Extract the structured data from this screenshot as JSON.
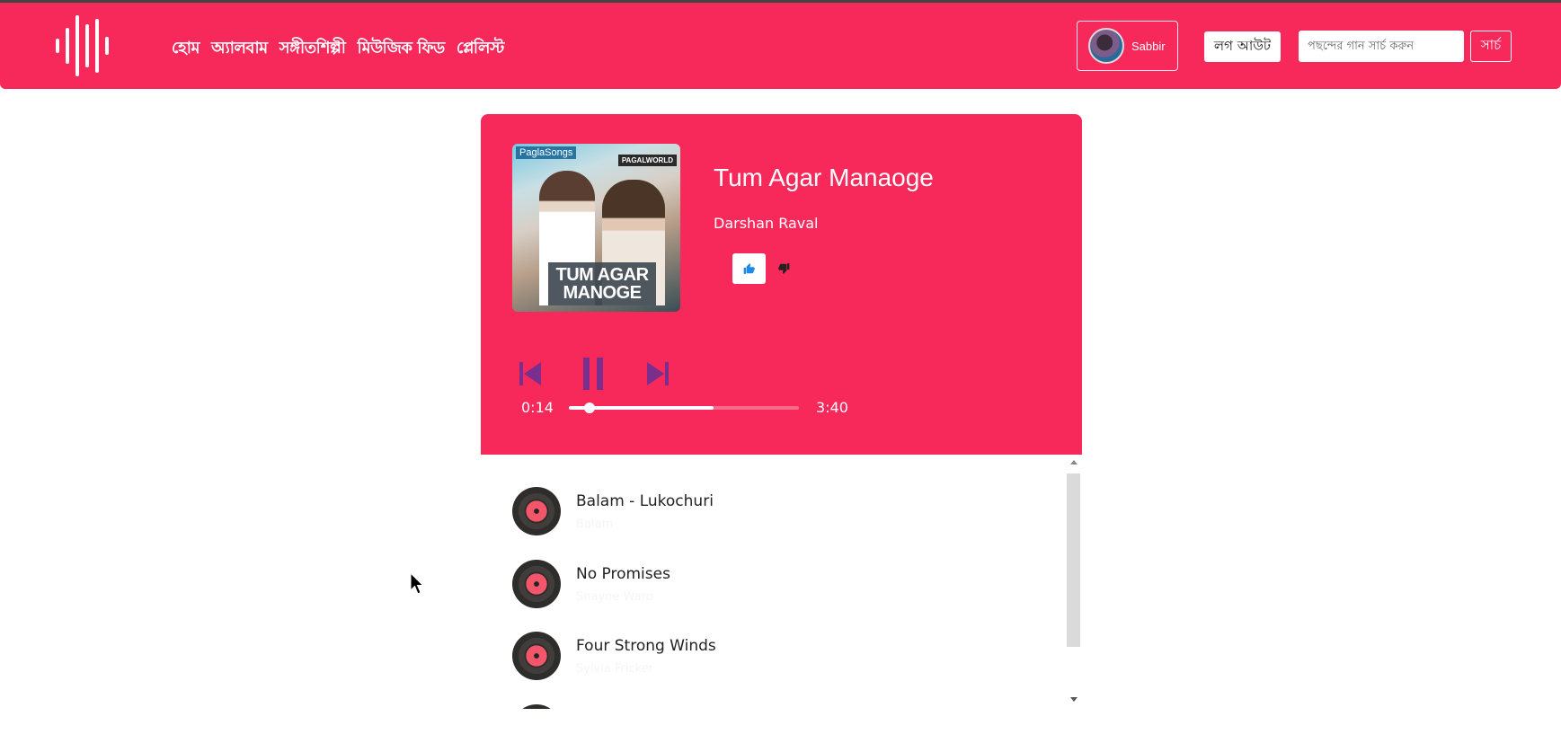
{
  "navbar": {
    "logo_icon": "sound-wave-icon",
    "links": [
      {
        "label": "হোম"
      },
      {
        "label": "অ্যালবাম"
      },
      {
        "label": "সঙ্গীতশিল্পী"
      },
      {
        "label": "মিউজিক ফিড"
      },
      {
        "label": "প্লেলিস্ট"
      }
    ],
    "user": {
      "name": "Sabbir"
    },
    "logout_label": "লগ আউট",
    "search": {
      "placeholder": "পছন্দের গান সার্চ করুন",
      "value": "",
      "button_label": "সার্চ"
    }
  },
  "player": {
    "cover": {
      "brand_text": "PaglaSongs",
      "badge_text": "PAGALWORLD",
      "title_text": "TUM AGAR MANOGE"
    },
    "title": "Tum Agar Manaoge",
    "artist": "Darshan Raval",
    "like_icon": "thumbs-up-icon",
    "dislike_icon": "thumbs-down-icon",
    "controls": {
      "prev_icon": "skip-previous-icon",
      "pause_icon": "pause-icon",
      "next_icon": "skip-next-icon"
    },
    "current_time": "0:14",
    "total_time": "3:40",
    "played_fraction": 0.09,
    "buffered_fraction": 0.63
  },
  "playlist": {
    "tracks": [
      {
        "title": "Balam - Lukochuri",
        "artist": "Balam"
      },
      {
        "title": "No Promises",
        "artist": "Shayne Ward"
      },
      {
        "title": "Four Strong Winds",
        "artist": "Sylvia Fricker"
      },
      {
        "title": "",
        "artist": ""
      }
    ]
  },
  "colors": {
    "accent": "#f7295a",
    "control_purple": "#7b2f8c",
    "like_blue": "#1e88e5"
  }
}
